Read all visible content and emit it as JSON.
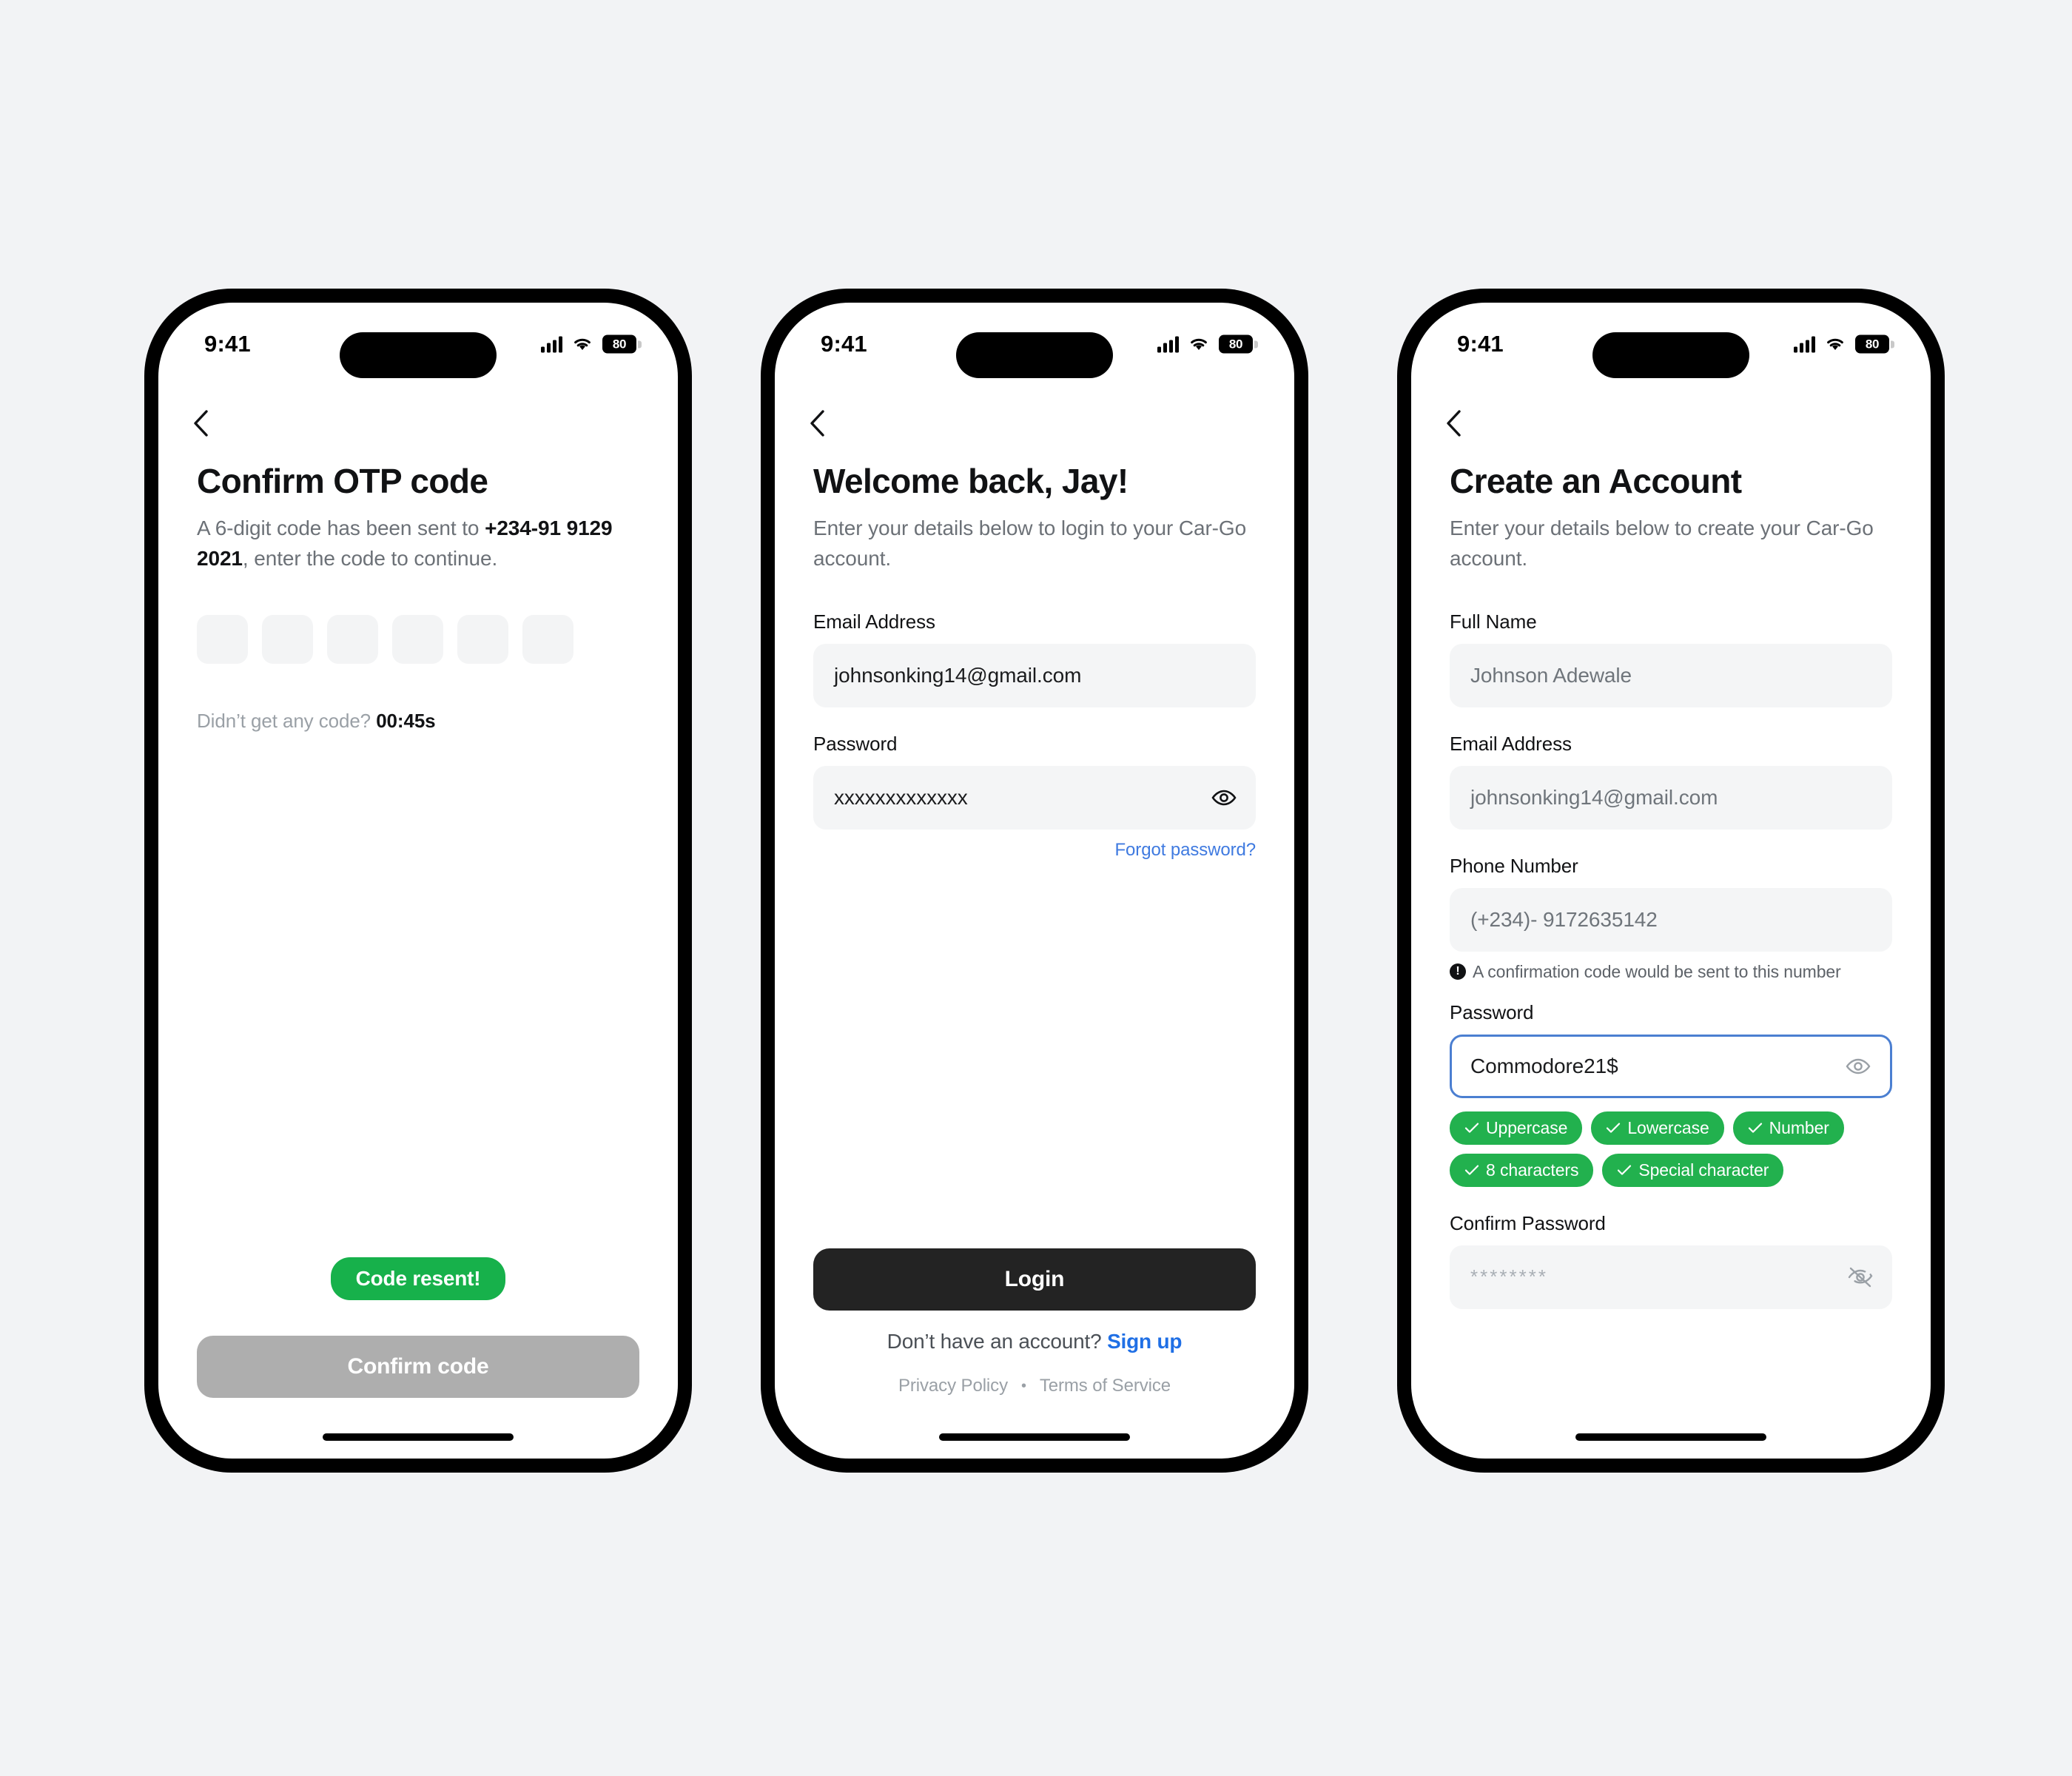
{
  "status_bar": {
    "time": "9:41",
    "battery_level": "80",
    "signal_icon": "cellular-bars-icon",
    "wifi_icon": "wifi-icon",
    "battery_icon": "battery-icon"
  },
  "screen_otp": {
    "back_icon": "chevron-left-icon",
    "title": "Confirm OTP code",
    "subtitle_pre": "A 6-digit code has been sent to ",
    "subtitle_phone": "+234-91 9129 2021",
    "subtitle_post": ", enter the code to continue.",
    "otp_boxes": [
      "",
      "",
      "",
      "",
      "",
      ""
    ],
    "resend_label": "Didn’t get any code?",
    "resend_timer": "00:45s",
    "toast_label": "Code resent!",
    "confirm_button": "Confirm code"
  },
  "screen_login": {
    "back_icon": "chevron-left-icon",
    "title": "Welcome back, Jay!",
    "subtitle": "Enter your details below to login to your Car-Go account.",
    "email_label": "Email Address",
    "email_value": "johnsonking14@gmail.com",
    "password_label": "Password",
    "password_value": "xxxxxxxxxxxxx",
    "password_eye_icon": "eye-icon",
    "forgot_password": "Forgot password?",
    "login_button": "Login",
    "signup_prompt": "Don’t have an account?",
    "signup_link": "Sign up",
    "privacy_policy": "Privacy Policy",
    "legal_separator": "•",
    "terms_of_service": "Terms of Service"
  },
  "screen_signup": {
    "back_icon": "chevron-left-icon",
    "title": "Create an Account",
    "subtitle": "Enter your details below to create your Car-Go account.",
    "fullname_label": "Full Name",
    "fullname_value": "Johnson Adewale",
    "email_label": "Email Address",
    "email_value": "johnsonking14@gmail.com",
    "phone_label": "Phone Number",
    "phone_value": "(+234)- 9172635142",
    "phone_hint": "A confirmation code would be sent to this number",
    "phone_hint_icon": "info-icon",
    "password_label": "Password",
    "password_value": "Commodore21$",
    "password_eye_icon": "eye-icon",
    "rules": [
      {
        "label": "Uppercase",
        "met": true
      },
      {
        "label": "Lowercase",
        "met": true
      },
      {
        "label": "Number",
        "met": true
      },
      {
        "label": "8 characters",
        "met": true
      },
      {
        "label": "Special character",
        "met": true
      }
    ],
    "confirm_password_label": "Confirm Password",
    "confirm_password_value": "********",
    "confirm_password_eye_icon": "eye-off-icon"
  },
  "colors": {
    "page_background": "#f2f3f5",
    "accent_green": "#22b14e",
    "toast_green": "#17b14b",
    "link_blue": "#3f7ae0",
    "signup_blue": "#1f6fe5",
    "focus_border_blue": "#4b7fd1",
    "dark_button": "#232323",
    "disabled_button": "#aeaeae",
    "field_background": "#f4f5f6",
    "text_primary": "#111214",
    "text_secondary": "#6c7177"
  }
}
